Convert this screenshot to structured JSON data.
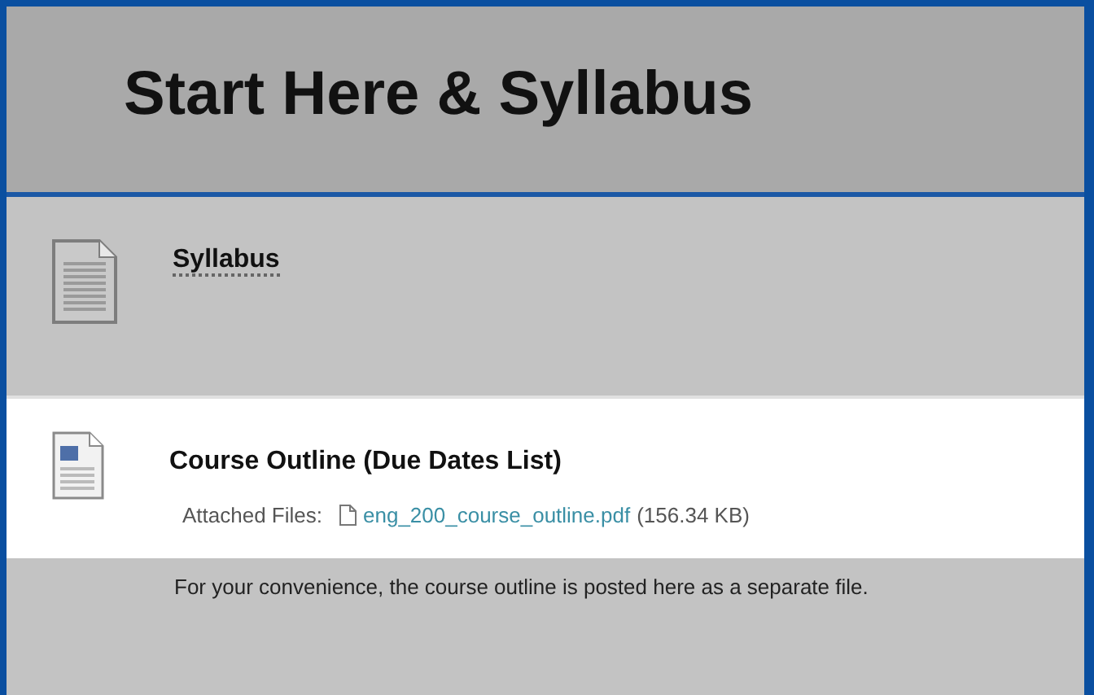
{
  "page_title": "Start Here & Syllabus",
  "items": [
    {
      "kind": "text",
      "title": "Syllabus"
    },
    {
      "kind": "image",
      "title": "Course Outline (Due Dates List)",
      "attachments": {
        "label": "Attached Files:",
        "file": "eng_200_course_outline.pdf",
        "size": "(156.34 KB)"
      },
      "description": "For your convenience, the course outline is posted here as a separate file."
    }
  ]
}
